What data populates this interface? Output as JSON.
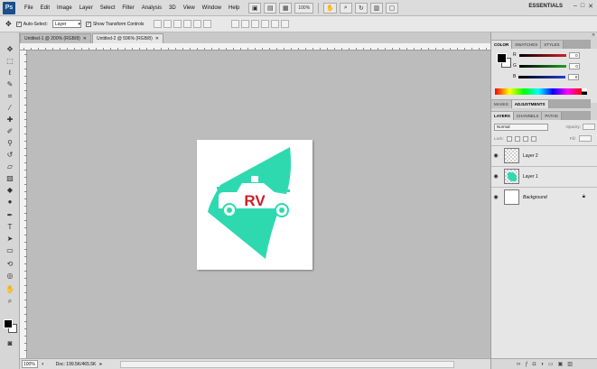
{
  "app": {
    "logo": "Ps",
    "workspace": "ESSENTIALS"
  },
  "menu": [
    "File",
    "Edit",
    "Image",
    "Layer",
    "Select",
    "Filter",
    "Analysis",
    "3D",
    "View",
    "Window",
    "Help"
  ],
  "menubar_tools": {
    "zoom": "100%"
  },
  "options": {
    "auto_select_label": "Auto-Select:",
    "auto_select_value": "Layer",
    "transform_label": "Show Transform Controls"
  },
  "tabs": [
    {
      "label": "Untitled-1 @ 200% (RGB/8)",
      "active": false
    },
    {
      "label": "Untitled-2 @ 596% (RGB/8)",
      "active": true
    }
  ],
  "status": {
    "zoom": "100%",
    "doc_info": "Doc: 199.5K/465.5K"
  },
  "color_panel": {
    "tabs": [
      "COLOR",
      "SWATCHES",
      "STYLES"
    ],
    "channels": [
      {
        "label": "R",
        "value": "0",
        "color": "#d42020"
      },
      {
        "label": "G",
        "value": "0",
        "color": "#20a020"
      },
      {
        "label": "B",
        "value": "0",
        "color": "#2040d0"
      }
    ]
  },
  "adjust_panel": {
    "tabs": [
      "MASKS",
      "ADJUSTMENTS"
    ]
  },
  "layers_panel": {
    "tabs": [
      "LAYERS",
      "CHANNELS",
      "PATHS"
    ],
    "blend_mode": "Normal",
    "opacity_label": "Opacity:",
    "lock_label": "Lock:",
    "fill_label": "Fill:",
    "layers": [
      {
        "name": "Layer 2",
        "thumb": "checker"
      },
      {
        "name": "Layer 1",
        "thumb": "shape"
      },
      {
        "name": "Background",
        "thumb": "white"
      }
    ]
  },
  "artwork": {
    "text": "RV",
    "shape_color": "#2fd9b0",
    "text_color": "#c8202a"
  }
}
